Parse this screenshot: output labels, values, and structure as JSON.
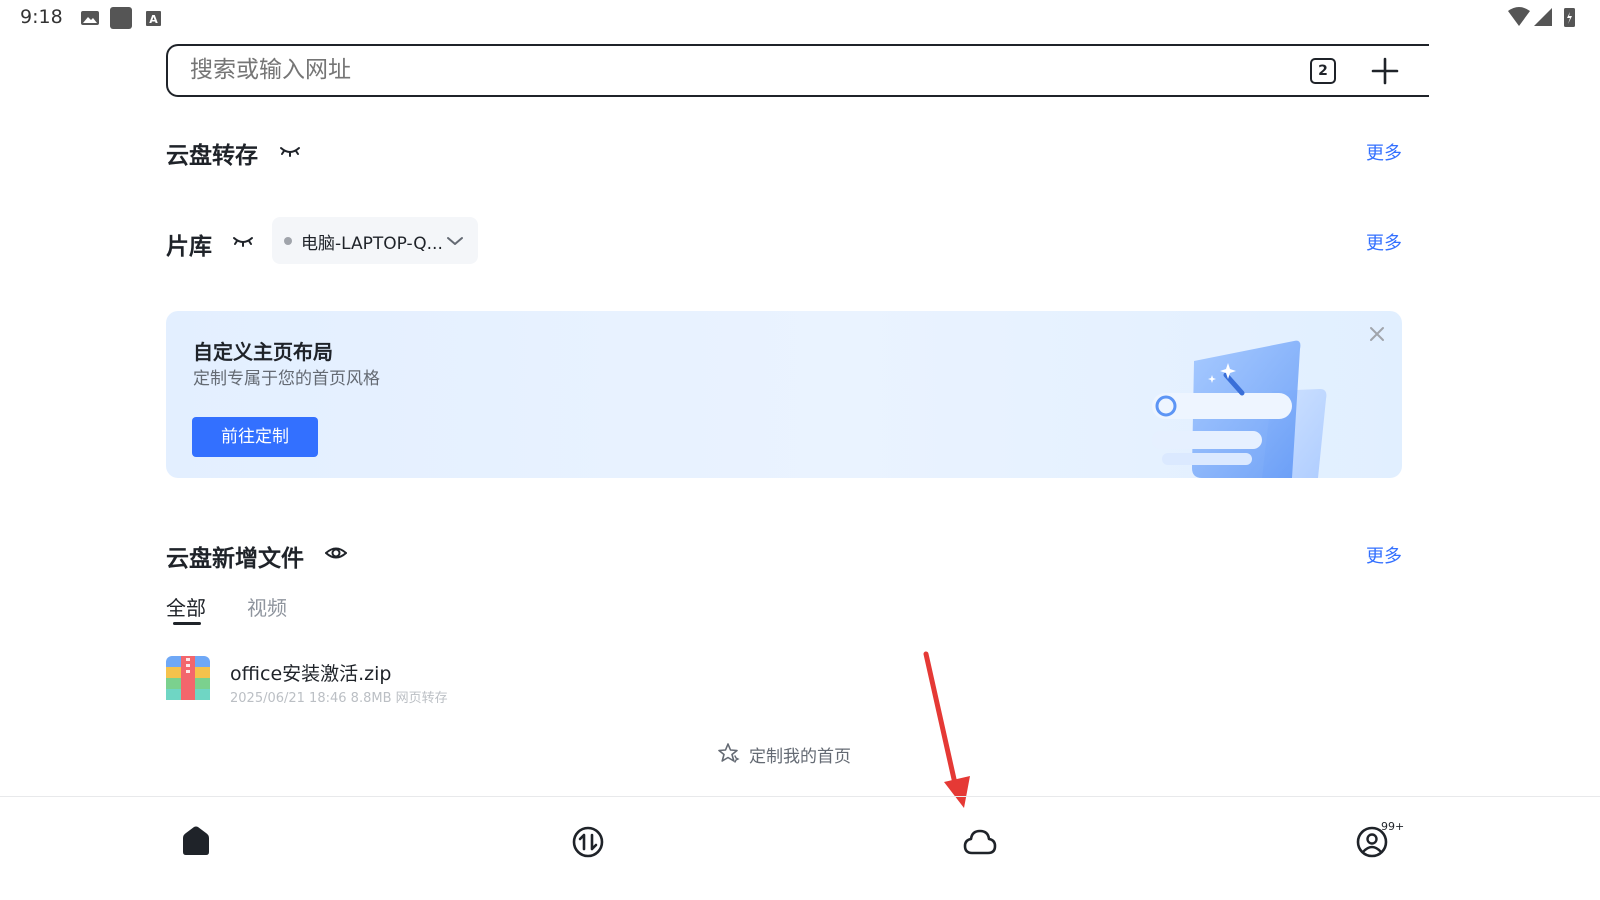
{
  "status_bar": {
    "time": "9:18",
    "icons_left": [
      "image-icon",
      "app-square-icon",
      "keyboard-a-icon"
    ],
    "icons_right": [
      "wifi-icon",
      "cell-signal-icon",
      "battery-charging-icon"
    ]
  },
  "search": {
    "placeholder": "搜索或输入网址",
    "tab_count": "2",
    "new_tab_icon": "plus-icon"
  },
  "sections": {
    "cloud_transfer": {
      "title": "云盘转存",
      "more": "更多",
      "visibility_icon": "eye-closed-icon"
    },
    "library": {
      "title": "片库",
      "more": "更多",
      "visibility_icon": "eye-closed-icon",
      "device_selector": "电脑-LAPTOP-Q..."
    },
    "banner": {
      "title": "自定义主页布局",
      "subtitle": "定制专属于您的首页风格",
      "button": "前往定制",
      "close_icon": "close-icon"
    },
    "new_files": {
      "title": "云盘新增文件",
      "more": "更多",
      "visibility_icon": "eye-open-icon",
      "tabs": [
        {
          "label": "全部",
          "active": true
        },
        {
          "label": "视频",
          "active": false
        }
      ],
      "files": [
        {
          "name": "office安装激活.zip",
          "date": "2025/06/21 18:46",
          "size": "8.8MB",
          "source": "网页转存",
          "icon": "zip-archive-icon"
        }
      ]
    }
  },
  "customize_link": {
    "label": "定制我的首页",
    "icon": "sparkle-star-icon"
  },
  "bottom_nav": {
    "items": [
      {
        "name": "home",
        "icon": "home-icon",
        "active": true
      },
      {
        "name": "transfer",
        "icon": "transfer-icon",
        "active": false
      },
      {
        "name": "cloud",
        "icon": "cloud-icon",
        "active": false
      },
      {
        "name": "profile",
        "icon": "user-circle-icon",
        "active": false
      }
    ],
    "profile_badge": "99+"
  },
  "colors": {
    "accent": "#3370ff",
    "text_primary": "#1f2329",
    "text_secondary": "#646a73",
    "text_muted": "#bbbfc4",
    "banner_bg": "#e3efff",
    "annotation_arrow": "#e53935"
  }
}
